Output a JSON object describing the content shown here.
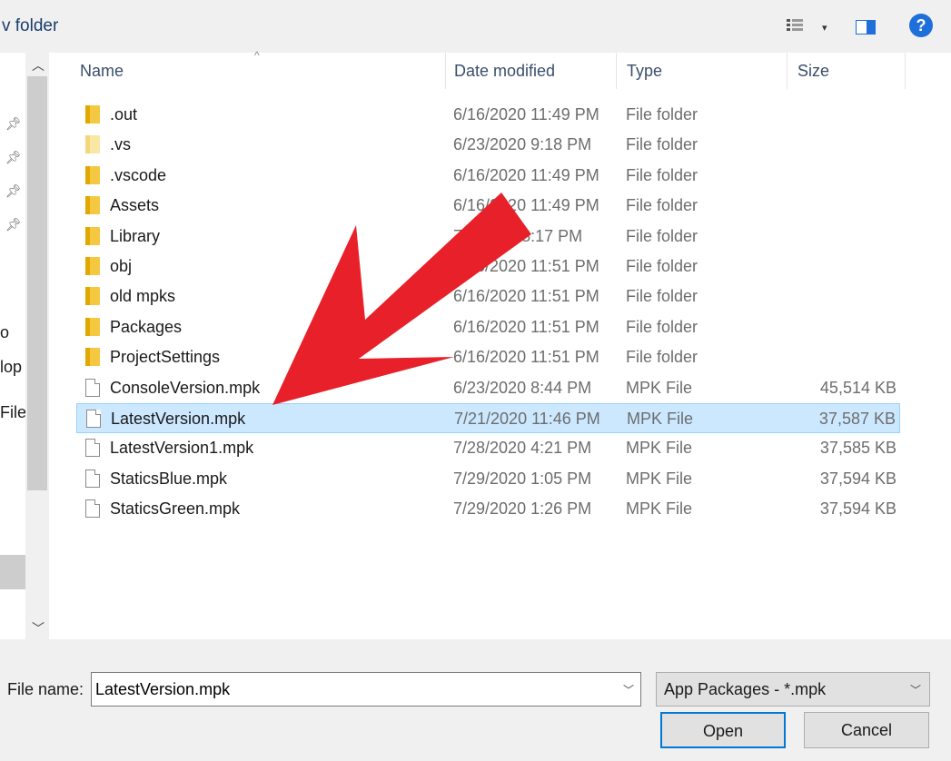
{
  "toolbar": {
    "new_folder_label": "v folder"
  },
  "nav": {
    "labels": [
      "o",
      "lop",
      "File"
    ]
  },
  "columns": {
    "name": "Name",
    "date": "Date modified",
    "type": "Type",
    "size": "Size"
  },
  "files": [
    {
      "name": ".out",
      "date": "6/16/2020 11:49 PM",
      "type": "File folder",
      "size": "",
      "kind": "folder"
    },
    {
      "name": ".vs",
      "date": "6/23/2020 9:18 PM",
      "type": "File folder",
      "size": "",
      "kind": "folder-light"
    },
    {
      "name": ".vscode",
      "date": "6/16/2020 11:49 PM",
      "type": "File folder",
      "size": "",
      "kind": "folder"
    },
    {
      "name": "Assets",
      "date": "6/16/2020 11:49 PM",
      "type": "File folder",
      "size": "",
      "kind": "folder"
    },
    {
      "name": "Library",
      "date": "7/2/2020 8:17 PM",
      "type": "File folder",
      "size": "",
      "kind": "folder"
    },
    {
      "name": "obj",
      "date": "6/16/2020 11:51 PM",
      "type": "File folder",
      "size": "",
      "kind": "folder"
    },
    {
      "name": "old mpks",
      "date": "6/16/2020 11:51 PM",
      "type": "File folder",
      "size": "",
      "kind": "folder"
    },
    {
      "name": "Packages",
      "date": "6/16/2020 11:51 PM",
      "type": "File folder",
      "size": "",
      "kind": "folder"
    },
    {
      "name": "ProjectSettings",
      "date": "6/16/2020 11:51 PM",
      "type": "File folder",
      "size": "",
      "kind": "folder"
    },
    {
      "name": "ConsoleVersion.mpk",
      "date": "6/23/2020 8:44 PM",
      "type": "MPK File",
      "size": "45,514 KB",
      "kind": "file"
    },
    {
      "name": "LatestVersion.mpk",
      "date": "7/21/2020 11:46 PM",
      "type": "MPK File",
      "size": "37,587 KB",
      "kind": "file",
      "selected": true
    },
    {
      "name": "LatestVersion1.mpk",
      "date": "7/28/2020 4:21 PM",
      "type": "MPK File",
      "size": "37,585 KB",
      "kind": "file"
    },
    {
      "name": "StaticsBlue.mpk",
      "date": "7/29/2020 1:05 PM",
      "type": "MPK File",
      "size": "37,594 KB",
      "kind": "file"
    },
    {
      "name": "StaticsGreen.mpk",
      "date": "7/29/2020 1:26 PM",
      "type": "MPK File",
      "size": "37,594 KB",
      "kind": "file"
    }
  ],
  "file_name": {
    "label": "File name:",
    "value": "LatestVersion.mpk"
  },
  "file_type": {
    "selected": "App Packages - *.mpk"
  },
  "buttons": {
    "open": "Open",
    "cancel": "Cancel"
  },
  "colors": {
    "accent": "#0078d7",
    "selection": "#cce8ff",
    "arrow": "#e8202a"
  }
}
